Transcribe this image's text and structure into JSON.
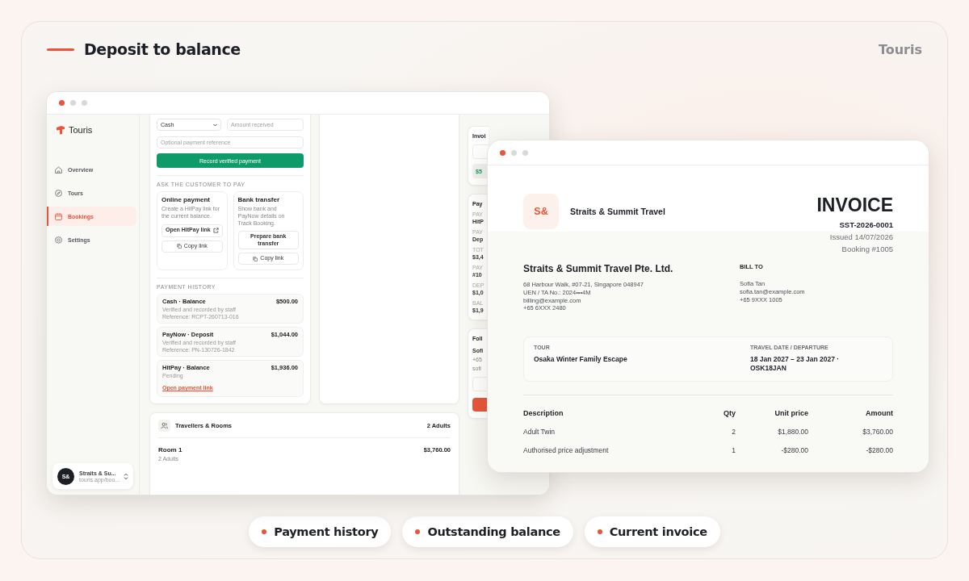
{
  "header": {
    "title": "Deposit to balance",
    "brand": "Touris"
  },
  "app_window": {
    "sidebar": {
      "logo": "Touris",
      "items": [
        {
          "label": "Overview",
          "selected": false
        },
        {
          "label": "Tours",
          "selected": false
        },
        {
          "label": "Bookings",
          "selected": true
        },
        {
          "label": "Settings",
          "selected": false
        }
      ],
      "account": {
        "initials": "S&",
        "name": "Straits & Su...",
        "url": "touris.app/boo..."
      }
    },
    "payment_form": {
      "method": "Cash",
      "amount_placeholder": "Amount received",
      "reference_placeholder": "Optional payment reference",
      "record_button": "Record verified payment"
    },
    "ask": {
      "heading": "ASK THE CUSTOMER TO PAY",
      "options": [
        {
          "title": "Online payment",
          "description": "Create a HitPay link for the current balance.",
          "primary_button": "Open HitPay link",
          "copy_button": "Copy link"
        },
        {
          "title": "Bank transfer",
          "description": "Show bank and PayNow details on Track Booking.",
          "primary_button": "Prepare bank transfer",
          "copy_button": "Copy link"
        }
      ]
    },
    "history": {
      "heading": "PAYMENT HISTORY",
      "entries": [
        {
          "kind": "verified",
          "title": "Cash · Balance",
          "amount": "$500.00",
          "note": "Verified and recorded by staff",
          "reference": "Reference: RCPT-260713-016"
        },
        {
          "kind": "verified",
          "title": "PayNow · Deposit",
          "amount": "$1,044.00",
          "note": "Verified and recorded by staff",
          "reference": "Reference: PN-130726-1842"
        },
        {
          "kind": "pending",
          "title": "HitPay · Balance",
          "amount": "$1,936.00",
          "note": "Pending",
          "link": "Open payment link"
        }
      ]
    },
    "side_panel": {
      "cards": [
        {
          "kind": "invoice",
          "title": "Invoi",
          "chip": "$5"
        },
        {
          "kind": "fields",
          "title": "Pay",
          "fields": [
            {
              "label": "PAY",
              "value": "HitP"
            },
            {
              "label": "PAY",
              "value": "Dep"
            },
            {
              "label": "TOT",
              "value": "$3,4"
            },
            {
              "label": "PAY",
              "value": "#10"
            },
            {
              "label": "DEP",
              "value": "$1,0"
            },
            {
              "label": "BAL",
              "value": "$1,9"
            }
          ]
        },
        {
          "kind": "contact",
          "title": "Foll",
          "name": "Sofi",
          "lines": [
            "+65",
            "sofi"
          ]
        }
      ]
    },
    "travellers": {
      "title": "Travellers & Rooms",
      "count": "2 Adults",
      "room": {
        "name": "Room 1",
        "guests": "2 Adults",
        "amount": "$3,760.00"
      }
    }
  },
  "invoice_window": {
    "company": {
      "initials": "S&",
      "name": "Straits & Summit Travel"
    },
    "title": "INVOICE",
    "number": "SST-2026-0001",
    "issued": "Issued 14/07/2026",
    "booking": "Booking #1005",
    "from": {
      "name": "Straits & Summit Travel Pte. Ltd.",
      "lines": [
        "68 Harbour Walk, #07-21, Singapore 048947",
        "UEN / TA No.: 2024•••4M",
        "billing@example.com",
        "+65 6XXX 2480"
      ]
    },
    "bill_to": {
      "heading": "BILL TO",
      "lines": [
        "Sofia Tan",
        "sofia.tan@example.com",
        "+65 9XXX 1005"
      ]
    },
    "tour": {
      "label": "TOUR",
      "value": "Osaka Winter Family Escape"
    },
    "travel": {
      "label": "TRAVEL DATE / DEPARTURE",
      "value": "18 Jan 2027 – 23 Jan 2027 · OSK18JAN"
    },
    "table": {
      "columns": [
        "Description",
        "Qty",
        "Unit price",
        "Amount"
      ],
      "rows": [
        [
          "Adult Twin",
          "2",
          "$1,880.00",
          "$3,760.00"
        ],
        [
          "Authorised price adjustment",
          "1",
          "-$280.00",
          "-$280.00"
        ]
      ]
    }
  },
  "highlights": [
    "Payment history",
    "Outstanding balance",
    "Current invoice"
  ]
}
